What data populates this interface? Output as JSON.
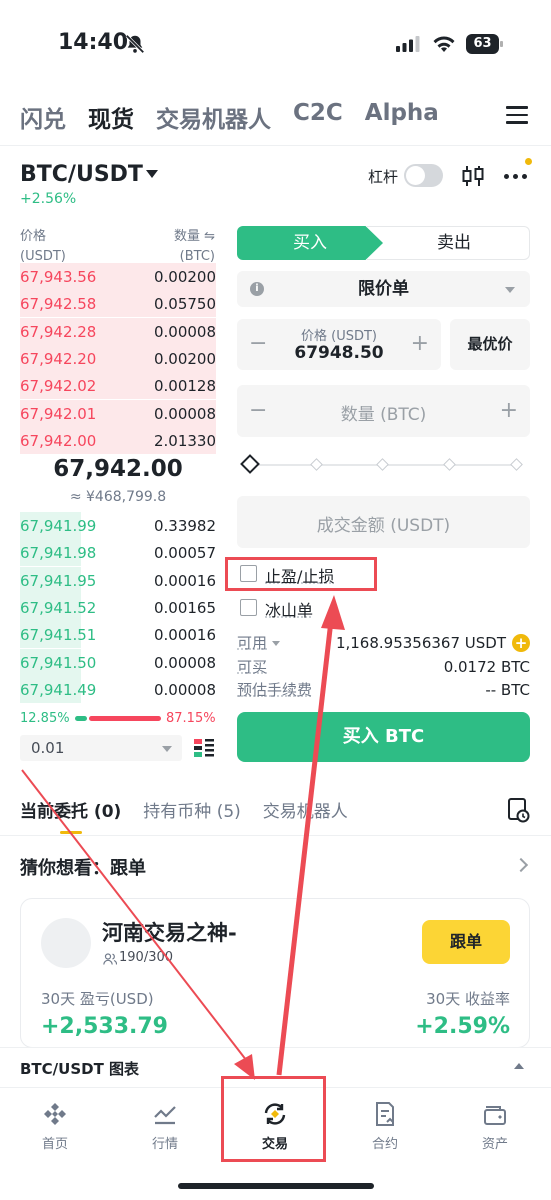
{
  "status_bar": {
    "time": "14:40",
    "battery": "63"
  },
  "top_nav": {
    "tabs": [
      "闪兑",
      "现货",
      "交易机器人",
      "C2C",
      "Alpha"
    ],
    "active_index": 1
  },
  "pair": {
    "symbol": "BTC/USDT",
    "change": "+2.56%",
    "leverage_label": "杠杆"
  },
  "order_book": {
    "price_header": "价格",
    "price_unit": "(USDT)",
    "qty_header": "数量",
    "qty_unit": "(BTC)",
    "asks": [
      {
        "price": "67,943.56",
        "qty": "0.00200",
        "depth": 1.0
      },
      {
        "price": "67,942.58",
        "qty": "0.05750",
        "depth": 1.0
      },
      {
        "price": "67,942.28",
        "qty": "0.00008",
        "depth": 1.0
      },
      {
        "price": "67,942.20",
        "qty": "0.00200",
        "depth": 1.0
      },
      {
        "price": "67,942.02",
        "qty": "0.00128",
        "depth": 1.0
      },
      {
        "price": "67,942.01",
        "qty": "0.00008",
        "depth": 1.0
      },
      {
        "price": "67,942.00",
        "qty": "2.01330",
        "depth": 1.0
      }
    ],
    "mid_price": "67,942.00",
    "mid_fiat": "≈ ¥468,799.8",
    "bids": [
      {
        "price": "67,941.99",
        "qty": "0.33982",
        "depth": 0.31
      },
      {
        "price": "67,941.98",
        "qty": "0.00057",
        "depth": 0.31
      },
      {
        "price": "67,941.95",
        "qty": "0.00016",
        "depth": 0.31
      },
      {
        "price": "67,941.52",
        "qty": "0.00165",
        "depth": 0.31
      },
      {
        "price": "67,941.51",
        "qty": "0.00016",
        "depth": 0.31
      },
      {
        "price": "67,941.50",
        "qty": "0.00008",
        "depth": 0.31
      },
      {
        "price": "67,941.49",
        "qty": "0.00008",
        "depth": 0.31
      }
    ],
    "buy_ratio": "12.85%",
    "sell_ratio": "87.15%",
    "precision": "0.01"
  },
  "order_form": {
    "buy_tab": "买入",
    "sell_tab": "卖出",
    "order_type": "限价单",
    "price_label": "价格 (USDT)",
    "price_value": "67948.50",
    "best_price": "最优价",
    "qty_placeholder": "数量 (BTC)",
    "amount_placeholder": "成交金额 (USDT)",
    "tp_sl_label": "止盈/止损",
    "iceberg_label": "冰山单",
    "available_label": "可用",
    "available_value": "1,168.95356367 USDT",
    "can_buy_label": "可买",
    "can_buy_value": "0.0172 BTC",
    "fee_label": "预估手续费",
    "fee_value": "-- BTC",
    "submit": "买入 BTC",
    "slider_value": 0
  },
  "orders_tabs": [
    {
      "label": "当前委托 (0)"
    },
    {
      "label": "持有币种 (5)"
    },
    {
      "label": "交易机器人"
    }
  ],
  "recommend": {
    "title": "猜你想看：跟单",
    "trader": {
      "name": "河南交易之神-",
      "followers": "190/300",
      "copy_button": "跟单",
      "pnl_label": "30天 盈亏(USD)",
      "pnl_value": "+2,533.79",
      "roi_label": "30天 收益率",
      "roi_value": "+2.59%"
    }
  },
  "chart_bar": {
    "label": "BTC/USDT 图表"
  },
  "bottom_nav": [
    {
      "label": "首页",
      "icon": "home-icon"
    },
    {
      "label": "行情",
      "icon": "markets-icon"
    },
    {
      "label": "交易",
      "icon": "trade-icon"
    },
    {
      "label": "合约",
      "icon": "futures-icon"
    },
    {
      "label": "资产",
      "icon": "wallet-icon"
    }
  ],
  "colors": {
    "buy": "#2ebd85",
    "sell": "#f6465d",
    "brand": "#f0b90b",
    "annotation": "#ec4b54"
  }
}
